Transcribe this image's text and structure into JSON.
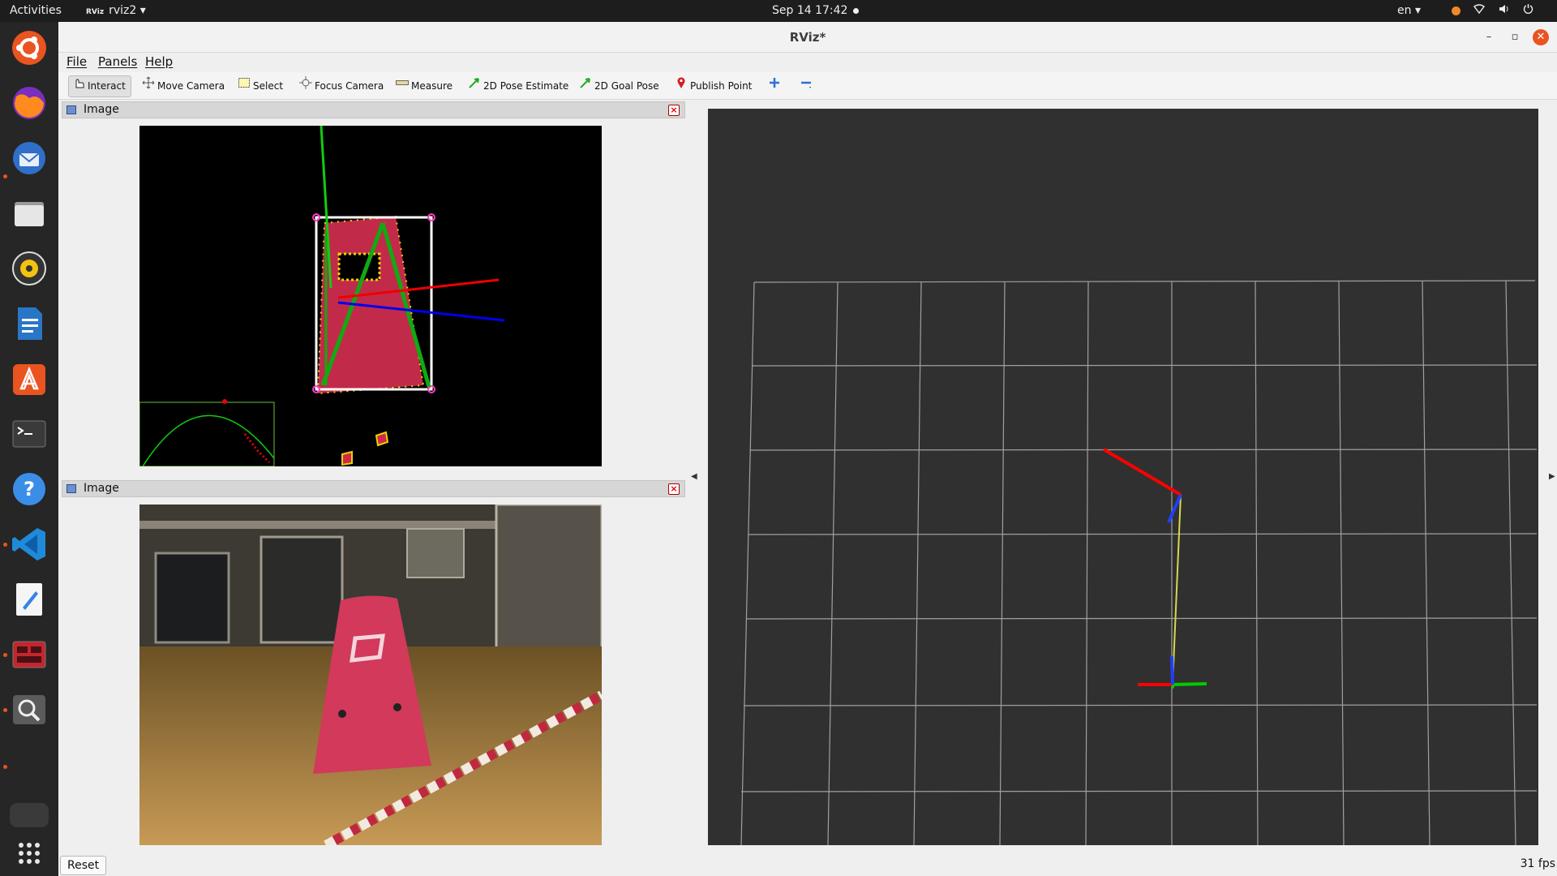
{
  "topbar": {
    "activities": "Activities",
    "app_menu": "rviz2",
    "app_icon_text": "RViz",
    "clock": "Sep 14  17:42",
    "language": "en"
  },
  "dock": {
    "apps": [
      "ubuntu-logo-icon",
      "firefox-icon",
      "thunderbird-icon",
      "files-icon",
      "rhythmbox-icon",
      "writer-icon",
      "software-icon",
      "terminal-icon",
      "help-icon",
      "vscode-icon",
      "text-editor-icon",
      "rviz-app-icon",
      "image-viewer-icon",
      "app-grid-icon"
    ]
  },
  "window": {
    "title": "RViz*",
    "menu": {
      "file": "File",
      "panels": "Panels",
      "help": "Help"
    },
    "toolbar": {
      "interact": "Interact",
      "move_camera": "Move Camera",
      "select": "Select",
      "focus_camera": "Focus Camera",
      "measure": "Measure",
      "pose_estimate": "2D Pose Estimate",
      "goal_pose": "2D Goal Pose",
      "publish_point": "Publish Point"
    },
    "panels": [
      {
        "title": "Image"
      },
      {
        "title": "Image"
      }
    ],
    "status": {
      "reset": "Reset",
      "fps": "31 fps"
    }
  },
  "colors": {
    "accent": "#e95420",
    "viewport_bg": "#303030",
    "grid": "#a0a0a0",
    "axis_x": "#ff0000",
    "axis_y": "#00cc00",
    "axis_z": "#0000ff",
    "link": "#d8d84a"
  }
}
